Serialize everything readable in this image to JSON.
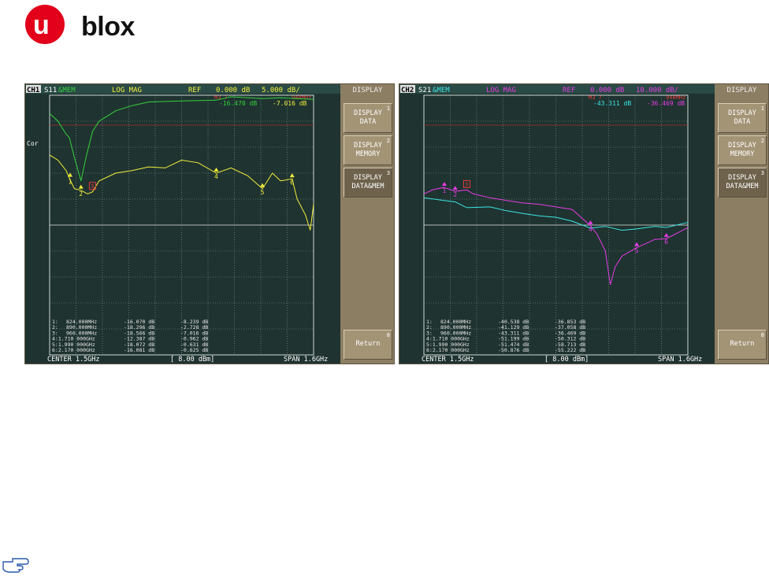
{
  "brand": {
    "logo_u": "u",
    "logo_text": "blox",
    "accent": "#e2001a"
  },
  "colors": {
    "data_trace_1": "#f5f03c",
    "memory_trace_1": "#35d23c",
    "data_trace_2": "#e63ce6",
    "memory_trace_2": "#3ce6e6",
    "grid": "#7fa39b",
    "screen_bg": "#1f3330",
    "panel_bg": "#8c7e63"
  },
  "panels": [
    {
      "channel": "CH1",
      "param": "S11",
      "mem": "&MEM",
      "format": "LOG MAG",
      "ref_label": "REF",
      "ref_value": "0.000 dB",
      "scale": "5.000 dB/",
      "marker_hdr": "M3   7",
      "marker_hdr2": "948MHz",
      "readout_a": "-16.470 dB",
      "readout_b": "-7.016 dB",
      "cor": "Cor",
      "bottom_center": "CENTER 1.5GHz",
      "bottom_power": "[ 8.00 dBm]",
      "bottom_span": "SPAN 1.6GHz",
      "marker_table": [
        {
          "id": "1:",
          "freq": "824.000MHz",
          "v1": "-16.070 dB",
          "v2": "-8.239 dB"
        },
        {
          "id": "2:",
          "freq": "890.000MHz",
          "v1": "-18.296 dB",
          "v2": "-2.728 dB"
        },
        {
          "id": "3:",
          "freq": "960.000MHz",
          "v1": "-18.566 dB",
          "v2": "-7.016 dB"
        },
        {
          "id": "4:1.710 000GHz",
          "freq": "",
          "v1": "-12.387 dB",
          "v2": "-0.962 dB"
        },
        {
          "id": "5:1.990 000GHz",
          "freq": "",
          "v1": "-18.072 dB",
          "v2": "-0.631 dB"
        },
        {
          "id": "6:2.170 000GHz",
          "freq": "",
          "v1": "-16.081 dB",
          "v2": "-0.625 dB"
        }
      ],
      "menu_title": "DISPLAY",
      "softkeys": [
        {
          "label1": "DISPLAY",
          "label2": "DATA",
          "num": "1",
          "active": false
        },
        {
          "label1": "DISPLAY",
          "label2": "MEMORY",
          "num": "2",
          "active": false
        },
        {
          "label1": "DISPLAY",
          "label2": "DATA&MEM",
          "num": "3",
          "active": true
        },
        {
          "label1": "Return",
          "label2": "",
          "num": "8",
          "active": false
        }
      ]
    },
    {
      "channel": "CH2",
      "param": "S21",
      "mem": "&MEM",
      "format": "LOG MAG",
      "ref_label": "REF",
      "ref_value": "0.000 dB",
      "scale": "10.000 dB/",
      "marker_hdr": "M3   7",
      "marker_hdr2": "948MHz",
      "readout_a": "-43.311 dB",
      "readout_b": "-36.469 dB",
      "cor": "",
      "bottom_center": "CENTER 1.5GHz",
      "bottom_power": "[ 8.00 dBm]",
      "bottom_span": "SPAN 1.6GHz",
      "marker_table": [
        {
          "id": "1:",
          "freq": "824.000MHz",
          "v1": "-40.538 dB",
          "v2": "-36.853 dB"
        },
        {
          "id": "2:",
          "freq": "890.000MHz",
          "v1": "-41.129 dB",
          "v2": "-37.058 dB"
        },
        {
          "id": "3:",
          "freq": "960.000MHz",
          "v1": "-43.311 dB",
          "v2": "-36.469 dB"
        },
        {
          "id": "4:1.710 000GHz",
          "freq": "",
          "v1": "-51.199 dB",
          "v2": "-50.312 dB"
        },
        {
          "id": "5:1.990 000GHz",
          "freq": "",
          "v1": "-51.474 dB",
          "v2": "-58.713 dB"
        },
        {
          "id": "6:2.170 000GHz",
          "freq": "",
          "v1": "-50.876 dB",
          "v2": "-55.222 dB"
        }
      ],
      "menu_title": "DISPLAY",
      "softkeys": [
        {
          "label1": "DISPLAY",
          "label2": "DATA",
          "num": "1",
          "active": false
        },
        {
          "label1": "DISPLAY",
          "label2": "MEMORY",
          "num": "2",
          "active": false
        },
        {
          "label1": "DISPLAY",
          "label2": "DATA&MEM",
          "num": "3",
          "active": true
        },
        {
          "label1": "Return",
          "label2": "",
          "num": "8",
          "active": false
        }
      ]
    }
  ],
  "chart_data": [
    {
      "type": "line",
      "title": "S11 LOG MAG",
      "ylabel": "dB",
      "xlim": [
        0.7,
        2.3
      ],
      "ylim": [
        -50,
        0
      ],
      "x_unit": "GHz",
      "series": [
        {
          "name": "S11",
          "role": "data",
          "x": [
            0.7,
            0.75,
            0.8,
            0.82,
            0.85,
            0.89,
            0.93,
            0.96,
            1.0,
            1.1,
            1.2,
            1.3,
            1.4,
            1.5,
            1.6,
            1.71,
            1.8,
            1.9,
            1.99,
            2.05,
            2.1,
            2.17,
            2.2,
            2.25,
            2.28,
            2.3
          ],
          "y": [
            -11.5,
            -12.5,
            -14.5,
            -16.0,
            -18.0,
            -18.3,
            -19.0,
            -18.6,
            -16.5,
            -15.0,
            -14.5,
            -13.8,
            -14.0,
            -12.5,
            -13.0,
            -15.0,
            -14.0,
            -15.5,
            -18.0,
            -15.0,
            -16.5,
            -16.1,
            -20.0,
            -23.0,
            -26.0,
            -21.0
          ]
        },
        {
          "name": "S11 MEM",
          "role": "memory",
          "x": [
            0.7,
            0.75,
            0.8,
            0.82,
            0.85,
            0.89,
            0.92,
            0.96,
            1.0,
            1.1,
            1.2,
            1.3,
            1.5,
            1.71,
            1.8,
            1.99,
            2.1,
            2.17,
            2.3
          ],
          "y": [
            -3.5,
            -5.0,
            -7.5,
            -8.2,
            -12.0,
            -16.5,
            -12.0,
            -7.0,
            -5.0,
            -3.0,
            -2.0,
            -1.3,
            -1.1,
            -0.96,
            -0.3,
            -0.63,
            -0.5,
            -0.6,
            -0.8
          ]
        }
      ],
      "markers": [
        {
          "id": "1",
          "x": 0.824
        },
        {
          "id": "2",
          "x": 0.89
        },
        {
          "id": "3",
          "x": 0.96
        },
        {
          "id": "4",
          "x": 1.71
        },
        {
          "id": "5",
          "x": 1.99
        },
        {
          "id": "6",
          "x": 2.17
        }
      ]
    },
    {
      "type": "line",
      "title": "S21 LOG MAG",
      "ylabel": "dB",
      "xlim": [
        0.7,
        2.3
      ],
      "ylim": [
        -100,
        0
      ],
      "x_unit": "GHz",
      "series": [
        {
          "name": "S21",
          "role": "data",
          "x": [
            0.7,
            0.75,
            0.82,
            0.89,
            0.96,
            1.0,
            1.1,
            1.2,
            1.3,
            1.4,
            1.5,
            1.6,
            1.71,
            1.75,
            1.8,
            1.83,
            1.86,
            1.9,
            1.99,
            2.05,
            2.1,
            2.17,
            2.3
          ],
          "y": [
            -38.0,
            -36.5,
            -35.5,
            -37.0,
            -36.5,
            -38.0,
            -39.5,
            -40.5,
            -41.5,
            -42.0,
            -43.0,
            -44.0,
            -50.3,
            -53.5,
            -60.0,
            -73.0,
            -66.0,
            -62.0,
            -58.7,
            -57.0,
            -55.5,
            -55.2,
            -51.0
          ]
        },
        {
          "name": "S21 MEM",
          "role": "memory",
          "x": [
            0.7,
            0.82,
            0.89,
            0.96,
            1.1,
            1.2,
            1.3,
            1.4,
            1.5,
            1.6,
            1.71,
            1.8,
            1.9,
            1.99,
            2.1,
            2.17,
            2.3
          ],
          "y": [
            -39.5,
            -40.5,
            -41.1,
            -43.3,
            -43.0,
            -44.5,
            -45.5,
            -46.5,
            -47.0,
            -48.5,
            -51.2,
            -50.5,
            -52.0,
            -51.5,
            -50.5,
            -50.9,
            -49.0
          ]
        }
      ],
      "markers": [
        {
          "id": "1",
          "x": 0.824
        },
        {
          "id": "2",
          "x": 0.89
        },
        {
          "id": "3",
          "x": 0.96
        },
        {
          "id": "4",
          "x": 1.71
        },
        {
          "id": "5",
          "x": 1.99
        },
        {
          "id": "6",
          "x": 2.17
        }
      ]
    }
  ]
}
